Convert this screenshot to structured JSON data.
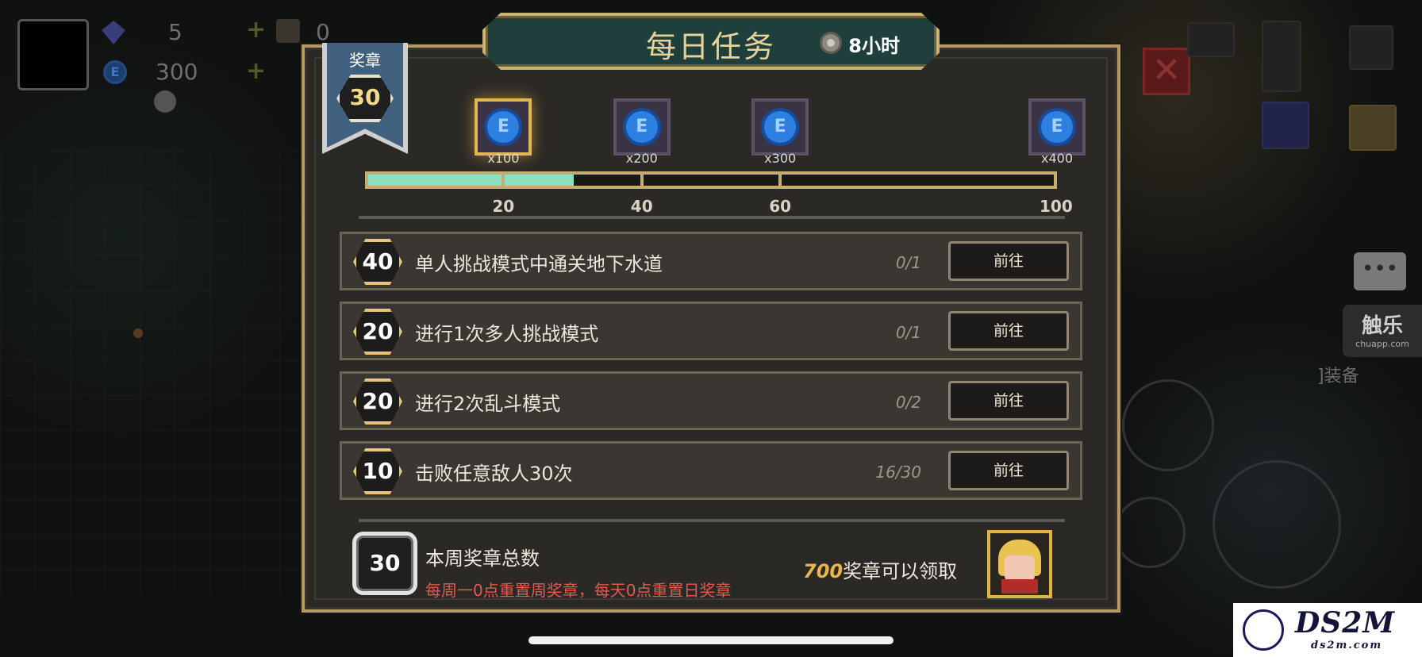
{
  "hud": {
    "gems": "5",
    "coins": "300",
    "keys": "0",
    "coin_icon_glyph": "E"
  },
  "panel": {
    "title": "每日任务",
    "timer": "8小时",
    "medal_label": "奖章",
    "medals": "30"
  },
  "rewards": [
    {
      "qty": "x100",
      "threshold": 20,
      "active": true
    },
    {
      "qty": "x200",
      "threshold": 40,
      "active": false
    },
    {
      "qty": "x300",
      "threshold": 60,
      "active": false
    },
    {
      "qty": "x400",
      "threshold": 100,
      "active": false
    }
  ],
  "reward_coin_glyph": "E",
  "progress": {
    "value": 30,
    "max": 100,
    "ticks": [
      "20",
      "40",
      "60",
      "100"
    ]
  },
  "tasks": [
    {
      "points": "40",
      "text": "单人挑战模式中通关地下水道",
      "progress": "0/1",
      "button": "前往"
    },
    {
      "points": "20",
      "text": "进行1次多人挑战模式",
      "progress": "0/1",
      "button": "前往"
    },
    {
      "points": "20",
      "text": "进行2次乱斗模式",
      "progress": "0/2",
      "button": "前往"
    },
    {
      "points": "10",
      "text": "击败任意敌人30次",
      "progress": "16/30",
      "button": "前往"
    }
  ],
  "weekly": {
    "count": "30",
    "title": "本周奖章总数",
    "note": "每周一0点重置周奖章，每天0点重置日奖章",
    "claim_number": "700",
    "claim_text": "奖章可以领取"
  },
  "side": {
    "equip_label": "]装备",
    "watermark_title": "触乐",
    "watermark_url": "chuapp.com"
  },
  "corner_watermark": {
    "title": "DS2M",
    "url": "ds2m.com"
  },
  "colors": {
    "accent_gold": "#c5ad6f",
    "progress_fill": "#8de0bf",
    "note_red": "#e25a4b",
    "title_plate": "#1f3f3d"
  },
  "icons": [
    "gem-icon",
    "coin-icon",
    "plus-icon",
    "close-icon",
    "chat-icon",
    "clock-icon",
    "medal-ribbon-icon",
    "energy-coin-icon"
  ]
}
